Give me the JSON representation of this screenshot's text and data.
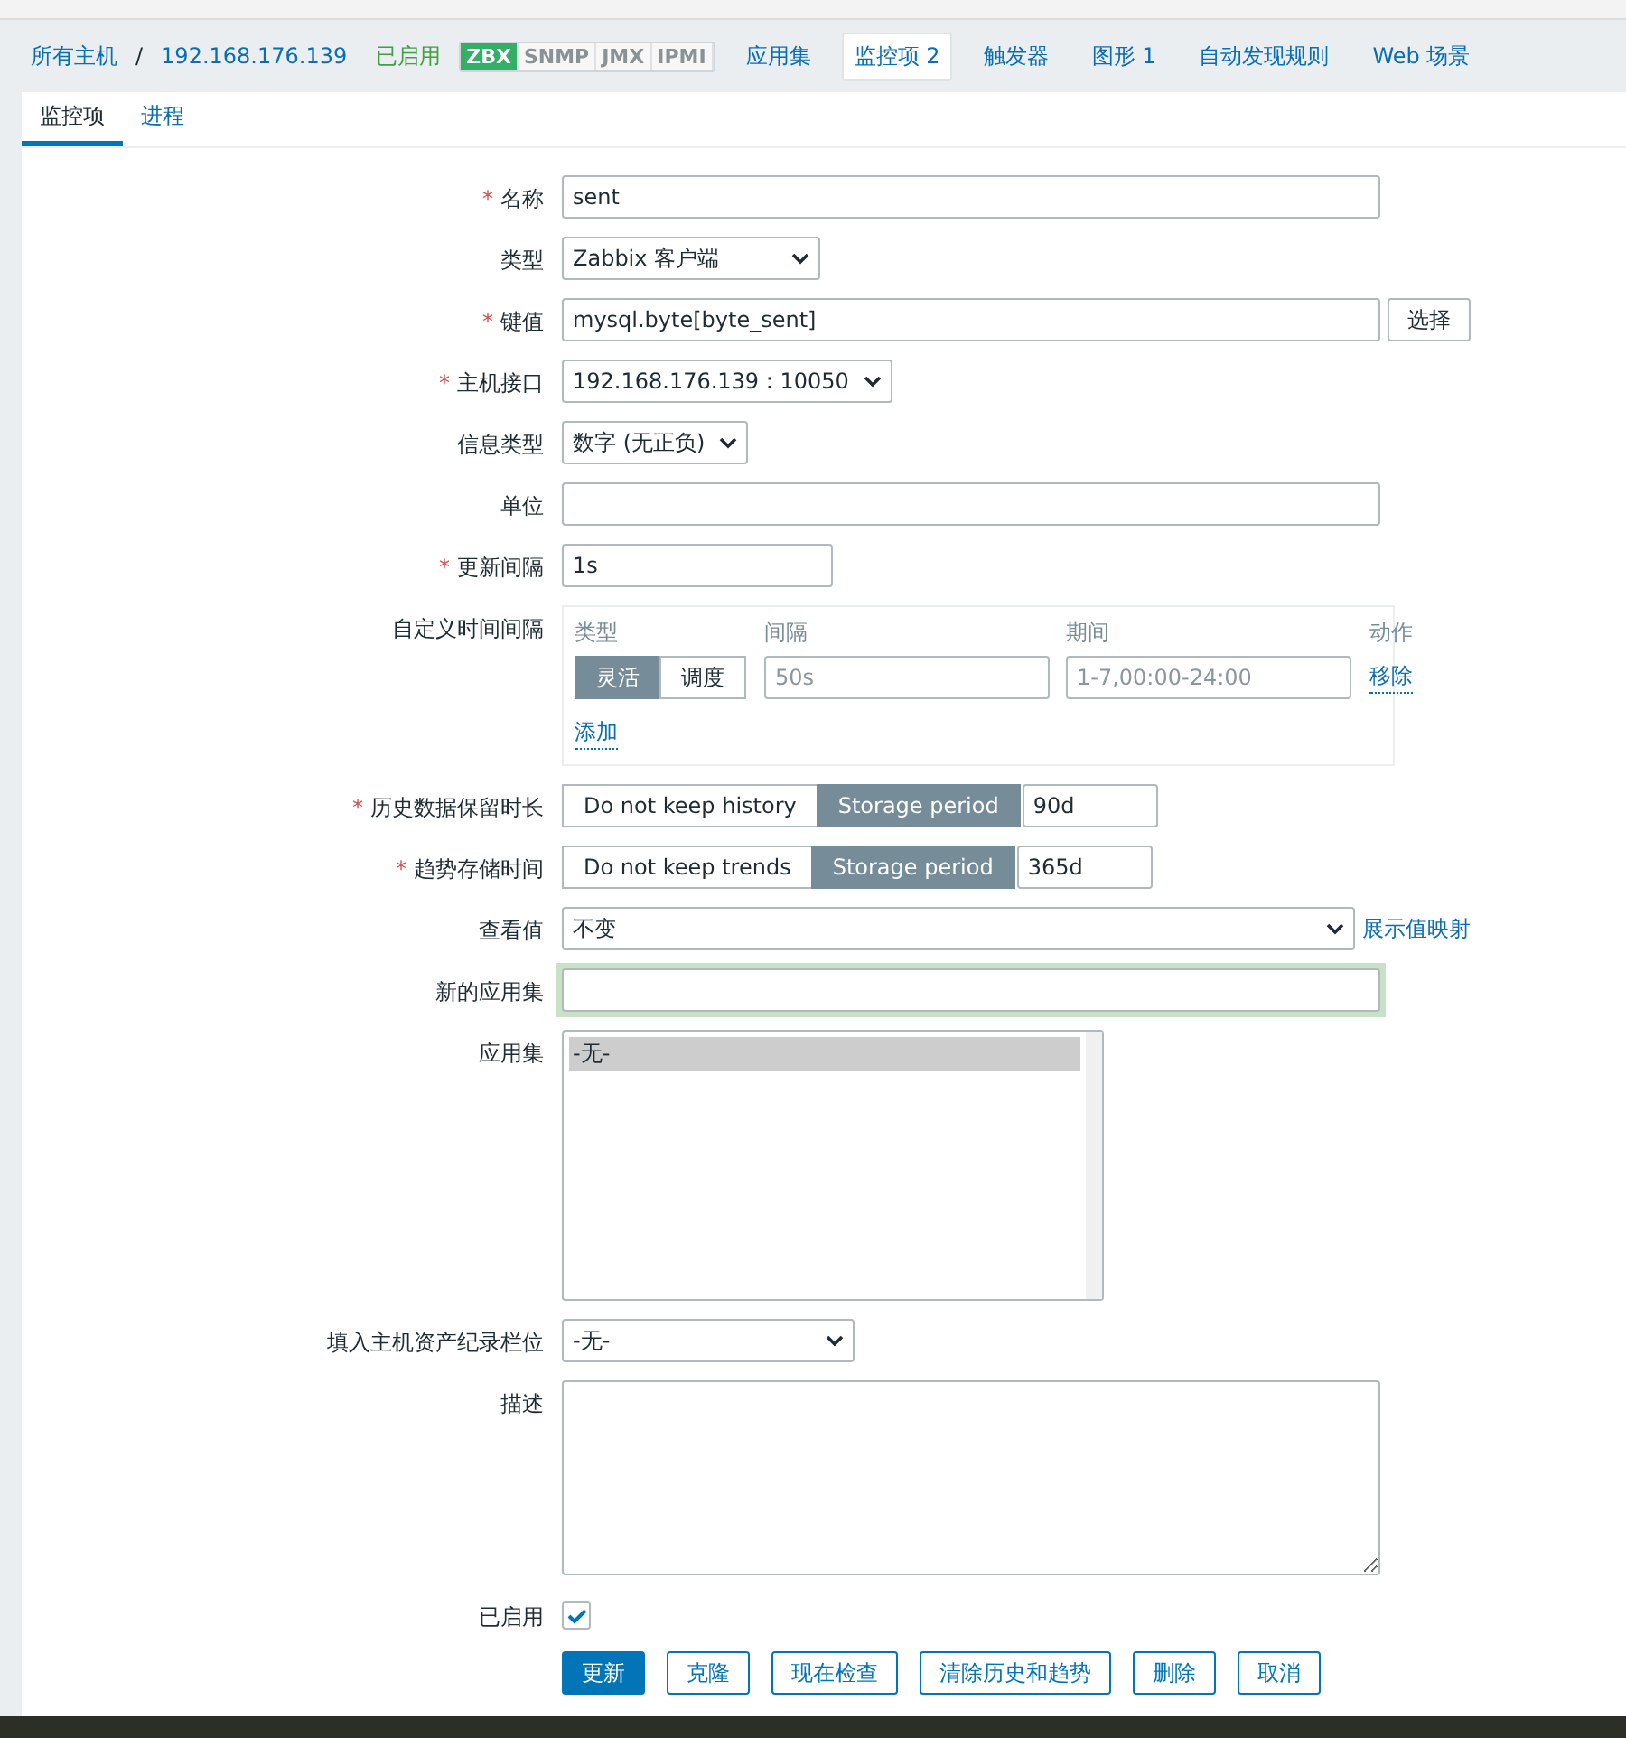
{
  "breadcrumb": {
    "items": [
      {
        "label": "所有主机",
        "kind": "link"
      },
      {
        "label": "/",
        "kind": "separator"
      },
      {
        "label": "192.168.176.139",
        "kind": "link"
      }
    ],
    "status": "已启用",
    "availability": [
      {
        "label": "ZBX",
        "on": true
      },
      {
        "label": "SNMP",
        "on": false
      },
      {
        "label": "JMX",
        "on": false
      },
      {
        "label": "IPMI",
        "on": false
      }
    ],
    "nav": [
      {
        "label": "应用集",
        "selected": false
      },
      {
        "label": "监控项",
        "count": "2",
        "selected": true
      },
      {
        "label": "触发器",
        "selected": false
      },
      {
        "label": "图形",
        "count": "1",
        "selected": false
      },
      {
        "label": "自动发现规则",
        "selected": false
      },
      {
        "label": "Web 场景",
        "selected": false
      }
    ]
  },
  "tabs": [
    {
      "label": "监控项",
      "selected": true
    },
    {
      "label": "进程",
      "selected": false
    }
  ],
  "form": {
    "required_mark": "*",
    "name": {
      "label": "名称",
      "required": true,
      "value": "sent"
    },
    "type": {
      "label": "类型",
      "required": false,
      "value": "Zabbix 客户端"
    },
    "key": {
      "label": "键值",
      "required": true,
      "value": "mysql.byte[byte_sent]",
      "button": "选择"
    },
    "interface": {
      "label": "主机接口",
      "required": true,
      "value": "192.168.176.139 : 10050"
    },
    "info_type": {
      "label": "信息类型",
      "required": false,
      "value": "数字 (无正负)"
    },
    "units": {
      "label": "单位",
      "required": false
    },
    "interval": {
      "label": "更新间隔",
      "required": true,
      "value": "1s"
    },
    "custom_intervals": {
      "label": "自定义时间间隔",
      "columns": [
        "类型",
        "间隔",
        "期间",
        "动作"
      ],
      "rows": [
        {
          "modes": [
            {
              "label": "灵活",
              "selected": true
            },
            {
              "label": "调度",
              "selected": false
            }
          ],
          "interval_placeholder": "50s",
          "period_placeholder": "1-7,00:00-24:00",
          "action": "移除"
        }
      ],
      "add": "添加"
    },
    "history": {
      "label": "历史数据保留时长",
      "required": true,
      "options": [
        {
          "label": "Do not keep history",
          "selected": false
        },
        {
          "label": "Storage period",
          "selected": true
        }
      ],
      "value": "90d"
    },
    "trends": {
      "label": "趋势存储时间",
      "required": true,
      "options": [
        {
          "label": "Do not keep trends",
          "selected": false
        },
        {
          "label": "Storage period",
          "selected": true
        }
      ],
      "value": "365d"
    },
    "valuemap": {
      "label": "查看值",
      "value": "不变",
      "link": "展示值映射"
    },
    "new_application": {
      "label": "新的应用集",
      "focused": true
    },
    "applications": {
      "label": "应用集",
      "items": [
        {
          "label": "-无-",
          "selected": true
        }
      ]
    },
    "inventory": {
      "label": "填入主机资产纪录栏位",
      "value": "-无-"
    },
    "description": {
      "label": "描述"
    },
    "enabled": {
      "label": "已启用",
      "checked": true
    }
  },
  "buttons": [
    {
      "label": "更新",
      "primary": true
    },
    {
      "label": "克隆",
      "primary": false
    },
    {
      "label": "现在检查",
      "primary": false
    },
    {
      "label": "清除历史和趋势",
      "primary": false
    },
    {
      "label": "删除",
      "primary": false
    },
    {
      "label": "取消",
      "primary": false
    }
  ]
}
